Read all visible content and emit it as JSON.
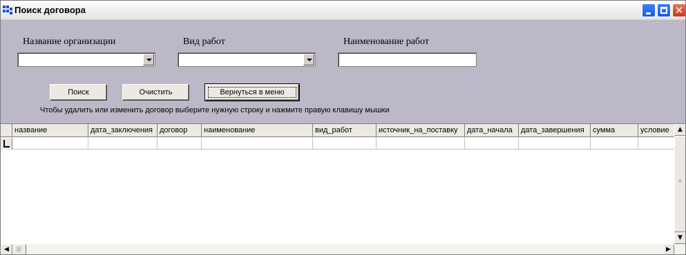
{
  "window": {
    "title": "Поиск договора",
    "controls": {
      "minimize": "minimize-icon",
      "maximize": "maximize-icon",
      "close": "close-icon"
    }
  },
  "form": {
    "org_label": "Название организации",
    "org_value": "",
    "work_type_label": "Вид работ",
    "work_type_value": "",
    "work_name_label": "Наименование работ",
    "work_name_value": ""
  },
  "buttons": {
    "search": "Поиск",
    "clear": "Очистить",
    "back": "Вернуться в меню"
  },
  "hint": "Чтобы удалить или изменить договор выберите нужную строку и нажмите правую клавишу мышки",
  "grid": {
    "columns": [
      "название",
      "дата_заключения",
      "договор",
      "наименование",
      "вид_работ",
      "источник_на_поставку",
      "дата_начала",
      "дата_завершения",
      "сумма",
      "условие"
    ],
    "rows": [
      [
        "",
        "",
        "",
        "",
        "",
        "",
        "",
        "",
        "",
        ""
      ]
    ]
  },
  "colors": {
    "window_bg": "#bcb8c8",
    "button_face": "#ece9e2",
    "xp_blue": "#1f5bd6",
    "xp_close": "#c8391a"
  }
}
